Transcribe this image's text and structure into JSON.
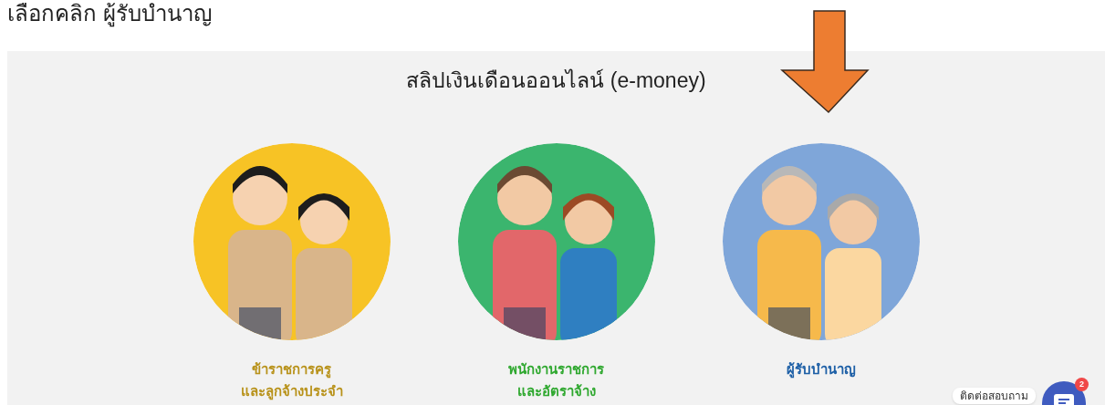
{
  "instruction": "เลือกคลิก ผู้รับบำนาญ",
  "title": "สลิปเงินเดือนออนไลน์ (e-money)",
  "options": [
    {
      "lines": [
        "ข้าราชการครู",
        "และลูกจ้างประจำ"
      ],
      "color": "#b8921a",
      "selected": false
    },
    {
      "lines": [
        "พนักงานราชการ",
        "และอัตราจ้าง"
      ],
      "color": "#2fa82f",
      "selected": false
    },
    {
      "lines": [
        "ผู้รับบำนาญ"
      ],
      "color": "#1d5fa6",
      "selected": true
    }
  ],
  "chat": {
    "label": "ติดต่อสอบถาม",
    "badge": "2"
  }
}
